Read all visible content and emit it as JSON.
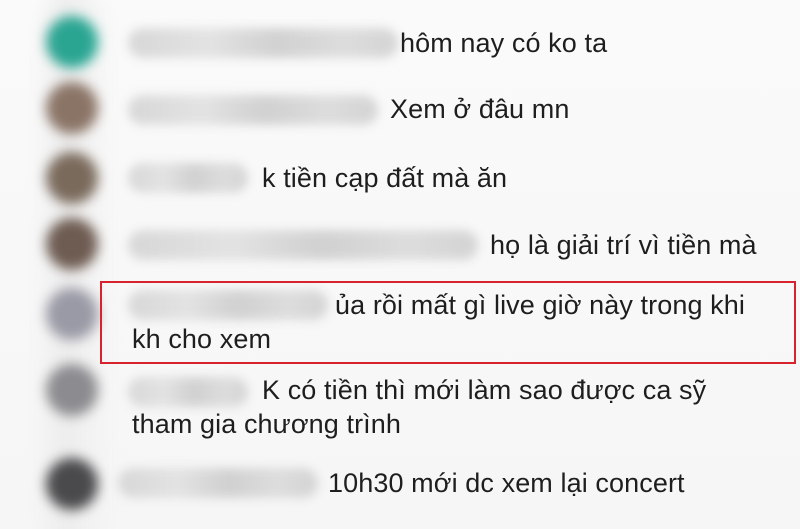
{
  "comments": [
    {
      "text": "hôm nay có ko ta"
    },
    {
      "text": "Xem ở đâu mn"
    },
    {
      "text": "k tiền cạp đất mà ăn"
    },
    {
      "text": "họ là giải trí vì tiền mà"
    },
    {
      "text_line1": "ủa rồi mất gì live giờ này trong khi",
      "text_line2": "kh cho xem"
    },
    {
      "text_line1": "K có tiền thì mới làm sao được ca sỹ",
      "text_line2": "tham gia chương trình"
    },
    {
      "text": "10h30 mới dc xem lại concert"
    }
  ],
  "highlight": {
    "color": "#d8232f"
  },
  "avatar_colors": [
    "#2aa592",
    "#8a7466",
    "#7a6a5c",
    "#6e5c52",
    "#9a9aa6",
    "#8c8c90",
    "#4a4a4c"
  ]
}
